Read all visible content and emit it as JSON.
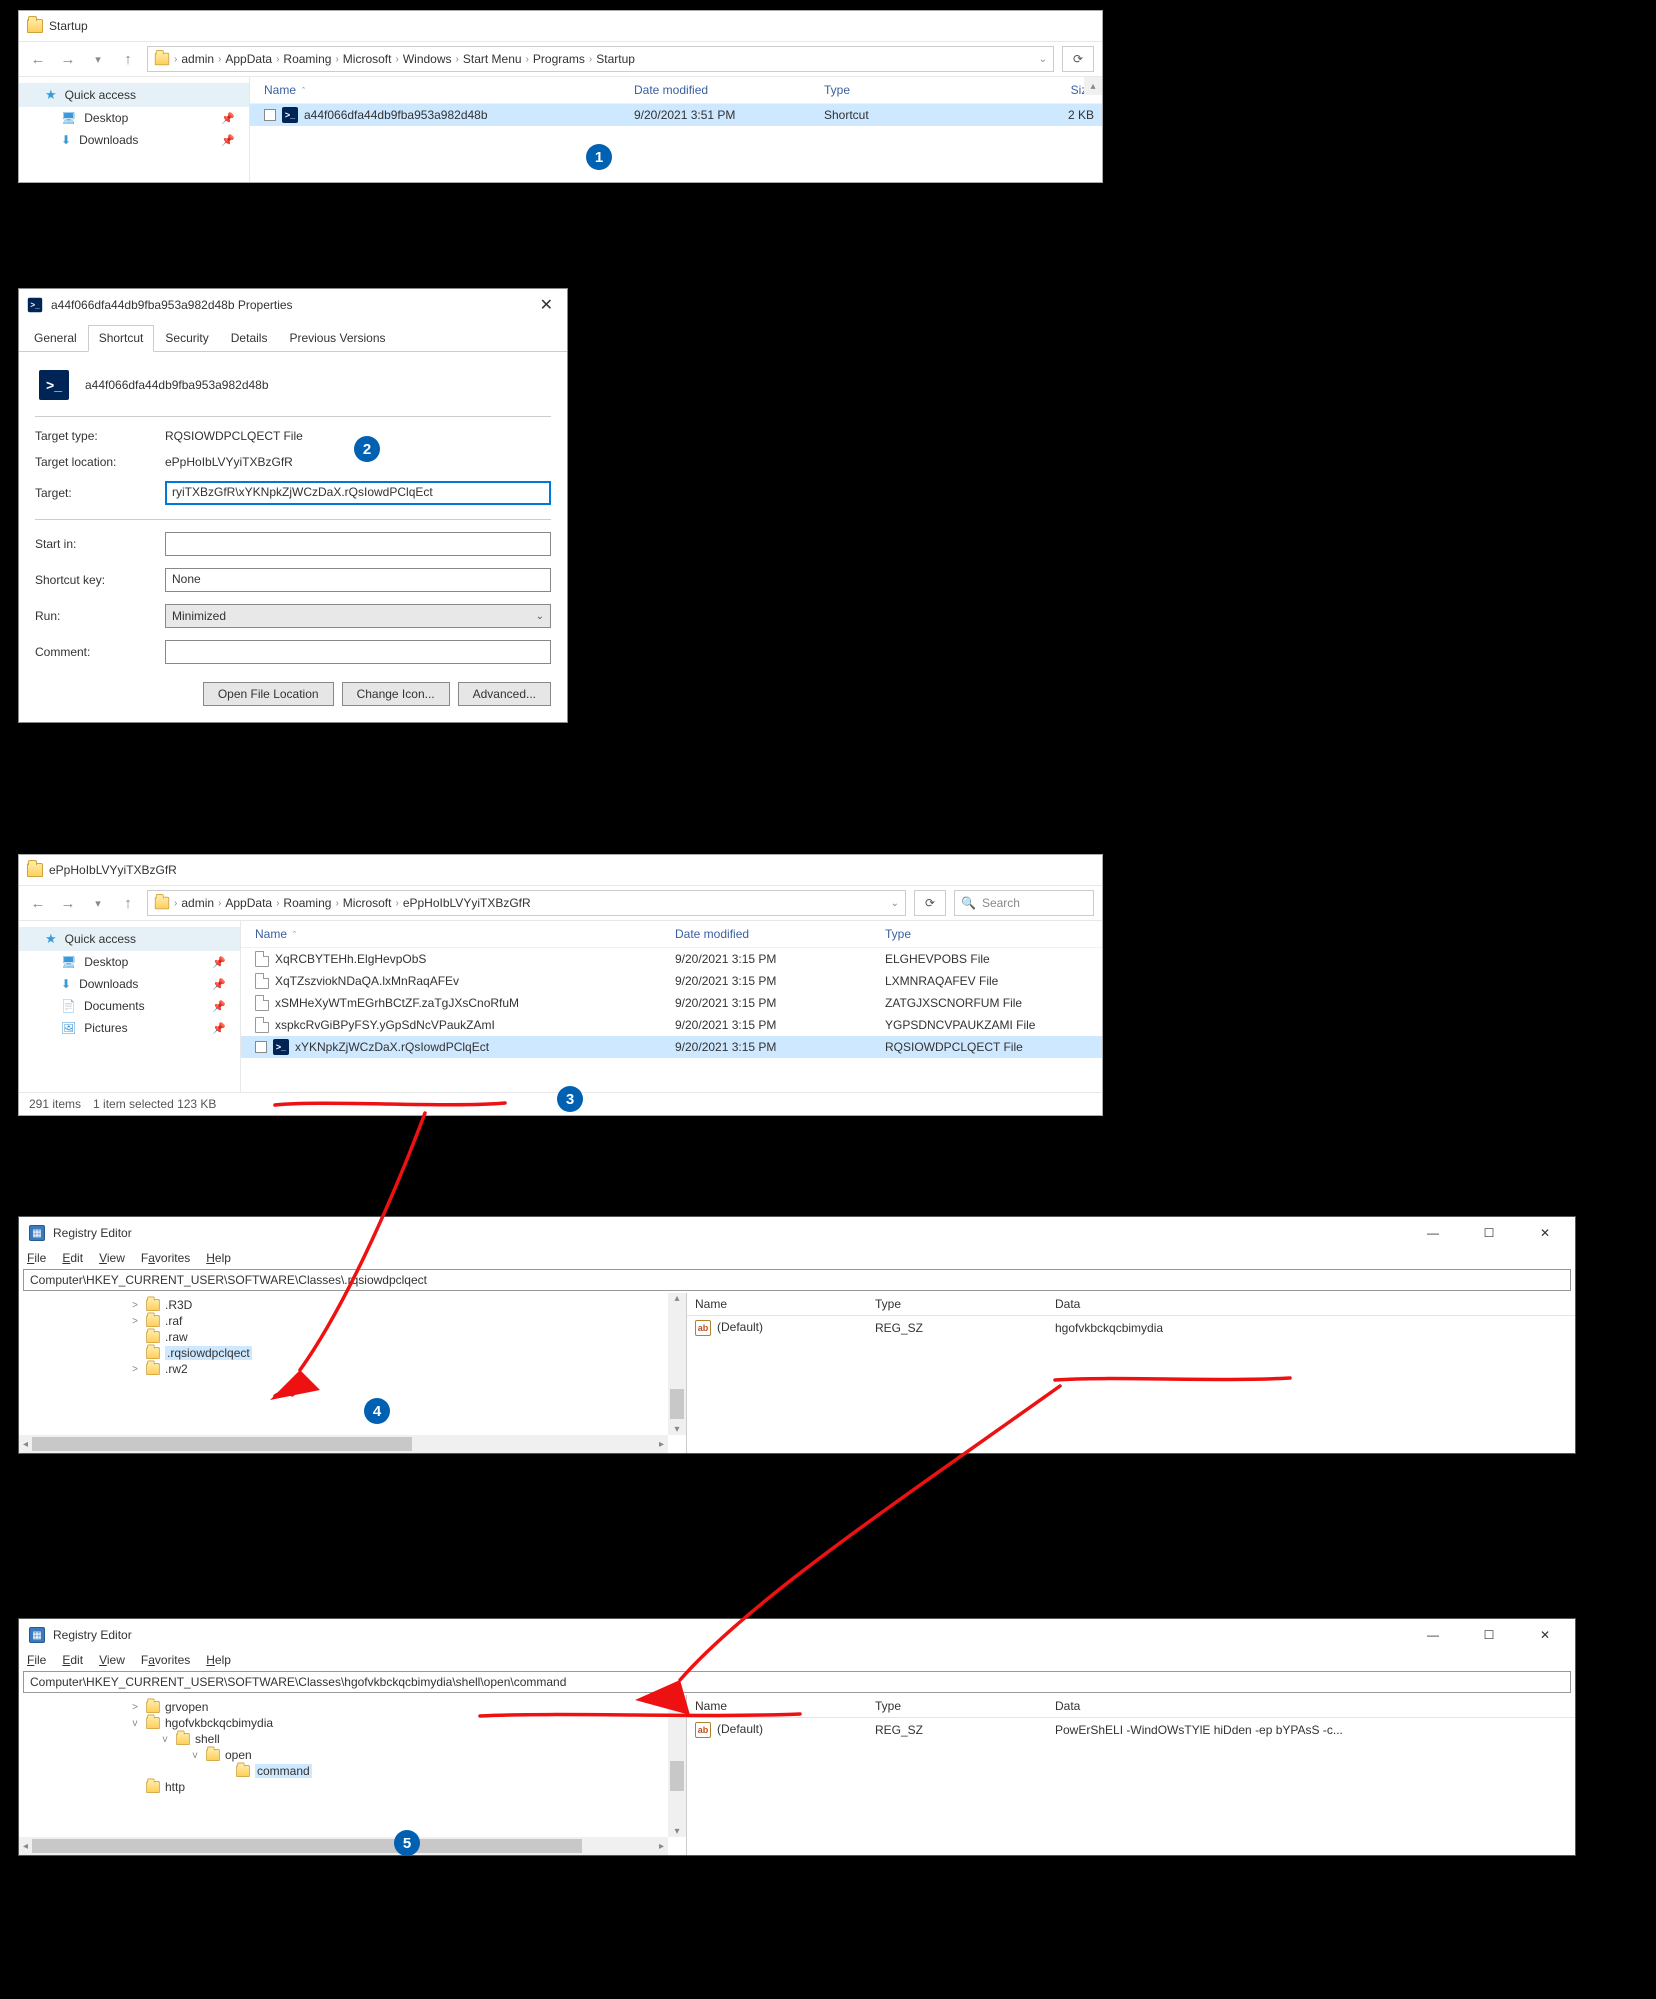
{
  "explorer1": {
    "title": "Startup",
    "breadcrumb": [
      "admin",
      "AppData",
      "Roaming",
      "Microsoft",
      "Windows",
      "Start Menu",
      "Programs",
      "Startup"
    ],
    "cols": {
      "name": "Name",
      "date": "Date modified",
      "type": "Type",
      "size": "Size"
    },
    "sidebar": {
      "quick": "Quick access",
      "desktop": "Desktop",
      "downloads": "Downloads"
    },
    "row": {
      "name": "a44f066dfa44db9fba953a982d48b",
      "date": "9/20/2021 3:51 PM",
      "type": "Shortcut",
      "size": "2 KB"
    },
    "badge": "1"
  },
  "props": {
    "title": "a44f066dfa44db9fba953a982d48b Properties",
    "tabs": {
      "general": "General",
      "shortcut": "Shortcut",
      "security": "Security",
      "details": "Details",
      "previous": "Previous Versions"
    },
    "name": "a44f066dfa44db9fba953a982d48b",
    "labels": {
      "targettype": "Target type:",
      "targetloc": "Target location:",
      "target": "Target:",
      "startin": "Start in:",
      "shortcutkey": "Shortcut key:",
      "run": "Run:",
      "comment": "Comment:"
    },
    "target_type": "RQSIOWDPCLQECT File",
    "target_loc": "ePpHoIbLVYyiTXBzGfR",
    "target": "ryiTXBzGfR\\xYKNpkZjWCzDaX.rQsIowdPClqEct",
    "startin": "",
    "shortcutkey": "None",
    "run": "Minimized",
    "comment": "",
    "buttons": {
      "open": "Open File Location",
      "icon": "Change Icon...",
      "adv": "Advanced..."
    },
    "badge": "2"
  },
  "explorer2": {
    "title": "ePpHoIbLVYyiTXBzGfR",
    "breadcrumb": [
      "admin",
      "AppData",
      "Roaming",
      "Microsoft",
      "ePpHoIbLVYyiTXBzGfR"
    ],
    "search_placeholder": "Search",
    "sidebar": {
      "quick": "Quick access",
      "desktop": "Desktop",
      "downloads": "Downloads",
      "documents": "Documents",
      "pictures": "Pictures"
    },
    "cols": {
      "name": "Name",
      "date": "Date modified",
      "type": "Type"
    },
    "rows": [
      {
        "name": "XqRCBYTEHh.ElgHevpObS",
        "date": "9/20/2021 3:15 PM",
        "type": "ELGHEVPOBS File"
      },
      {
        "name": "XqTZszviokNDaQA.lxMnRaqAFEv",
        "date": "9/20/2021 3:15 PM",
        "type": "LXMNRAQAFEV File"
      },
      {
        "name": "xSMHeXyWTmEGrhBCtZF.zaTgJXsCnoRfuM",
        "date": "9/20/2021 3:15 PM",
        "type": "ZATGJXSCNORFUM File"
      },
      {
        "name": "xspkcRvGiBPyFSY.yGpSdNcVPaukZAmI",
        "date": "9/20/2021 3:15 PM",
        "type": "YGPSDNCVPAUKZAMI File"
      },
      {
        "name": "xYKNpkZjWCzDaX.rQsIowdPClqEct",
        "date": "9/20/2021 3:15 PM",
        "type": "RQSIOWDPCLQECT File",
        "selected": true
      }
    ],
    "status": {
      "items": "291 items",
      "selected": "1 item selected  123 KB"
    },
    "badge": "3"
  },
  "reg1": {
    "title": "Registry Editor",
    "menus": {
      "file": "File",
      "edit": "Edit",
      "view": "View",
      "fav": "Favorites",
      "help": "Help"
    },
    "address": "Computer\\HKEY_CURRENT_USER\\SOFTWARE\\Classes\\.rqsiowdpclqect",
    "tree": [
      {
        "indent": 110,
        "tw": ">",
        "label": ".R3D"
      },
      {
        "indent": 110,
        "tw": ">",
        "label": ".raf"
      },
      {
        "indent": 110,
        "tw": "",
        "label": ".raw"
      },
      {
        "indent": 110,
        "tw": "",
        "label": ".rqsiowdpclqect",
        "sel": true
      },
      {
        "indent": 110,
        "tw": ">",
        "label": ".rw2"
      }
    ],
    "cols": {
      "name": "Name",
      "type": "Type",
      "data": "Data"
    },
    "val": {
      "name": "(Default)",
      "type": "REG_SZ",
      "data": "hgofvkbckqcbimydia"
    },
    "badge": "4"
  },
  "reg2": {
    "title": "Registry Editor",
    "menus": {
      "file": "File",
      "edit": "Edit",
      "view": "View",
      "fav": "Favorites",
      "help": "Help"
    },
    "address": "Computer\\HKEY_CURRENT_USER\\SOFTWARE\\Classes\\hgofvkbckqcbimydia\\shell\\open\\command",
    "tree": [
      {
        "indent": 110,
        "tw": ">",
        "label": "grvopen"
      },
      {
        "indent": 110,
        "tw": "v",
        "label": "hgofvkbckqcbimydia"
      },
      {
        "indent": 140,
        "tw": "v",
        "label": "shell"
      },
      {
        "indent": 170,
        "tw": "v",
        "label": "open"
      },
      {
        "indent": 200,
        "tw": "",
        "label": "command",
        "sel": true
      },
      {
        "indent": 110,
        "tw": "",
        "label": "http"
      }
    ],
    "cols": {
      "name": "Name",
      "type": "Type",
      "data": "Data"
    },
    "val": {
      "name": "(Default)",
      "type": "REG_SZ",
      "data": "PowErShELI -WindOWsTYlE hiDden -ep bYPAsS -c..."
    },
    "badge": "5"
  }
}
